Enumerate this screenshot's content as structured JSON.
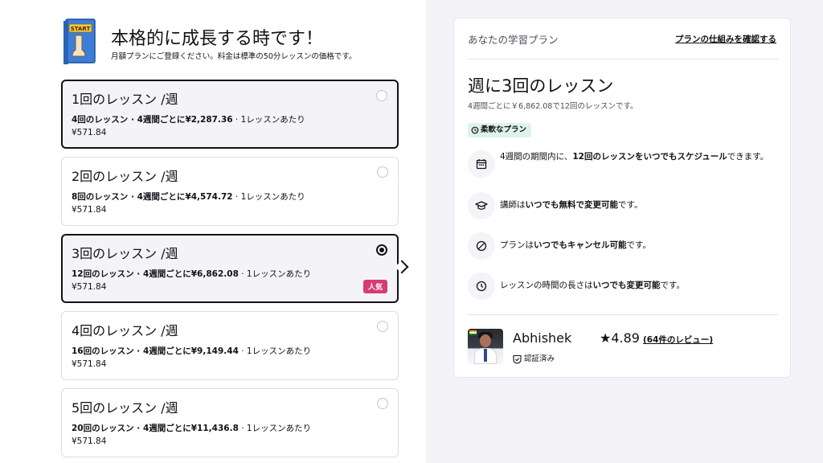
{
  "header": {
    "title": "本格的に成長する時です！",
    "subtitle": "月額プランにご登録ください。料金は標準の50分レッスンの価格です。",
    "book_label": "START"
  },
  "plans": [
    {
      "title": "1回のレッスン /週",
      "lessons": "4回のレッスン",
      "period": "4週間ごとに",
      "total": "¥2,287.36",
      "per_lesson_label": "1レッスンあたり",
      "price": "¥571.84",
      "selected": false
    },
    {
      "title": "2回のレッスン /週",
      "lessons": "8回のレッスン",
      "period": "4週間ごとに",
      "total": "¥4,574.72",
      "per_lesson_label": "1レッスンあたり",
      "price": "¥571.84",
      "selected": false
    },
    {
      "title": "3回のレッスン /週",
      "lessons": "12回のレッスン",
      "period": "4週間ごとに",
      "total": "¥6,862.08",
      "per_lesson_label": "1レッスンあたり",
      "price": "¥571.84",
      "selected": true,
      "badge": "人気"
    },
    {
      "title": "4回のレッスン /週",
      "lessons": "16回のレッスン",
      "period": "4週間ごとに",
      "total": "¥9,149.44",
      "per_lesson_label": "1レッスンあたり",
      "price": "¥571.84",
      "selected": false
    },
    {
      "title": "5回のレッスン /週",
      "lessons": "20回のレッスン",
      "period": "4週間ごとに",
      "total": "¥11,436.8",
      "per_lesson_label": "1レッスンあたり",
      "price": "¥571.84",
      "selected": false
    }
  ],
  "panel": {
    "heading": "あなたの学習プラン",
    "how_it_works_link": "プランの仕組みを確認する",
    "plan_name": "週に3回のレッスン",
    "plan_sub": "4週間ごとに￥6,862.08で12回のレッスンです。",
    "flex_badge": "柔軟なプラン",
    "features": [
      {
        "icon": "calendar-icon",
        "pre": "4週間の期間内に、",
        "bold": "12回のレッスンをいつでもスケジュール",
        "post": "できます。"
      },
      {
        "icon": "graduation-cap-icon",
        "pre": "講師は",
        "bold": "いつでも無料で変更可能",
        "post": "です。"
      },
      {
        "icon": "cancel-icon",
        "pre": "プランは",
        "bold": "いつでもキャンセル可能",
        "post": "です。"
      },
      {
        "icon": "clock-icon",
        "pre": "レッスンの時間の長さは",
        "bold": "いつでも変更可能",
        "post": "です。"
      }
    ],
    "tutor": {
      "name": "Abhishek",
      "rating": "★4.89",
      "reviews": "(64件のレビュー)",
      "verified": "認証済み"
    }
  },
  "colors": {
    "accent": "#121117",
    "badge_pink": "#d63c6f",
    "flex_badge_bg": "#dff3ee",
    "right_bg": "#f4f4f8"
  }
}
